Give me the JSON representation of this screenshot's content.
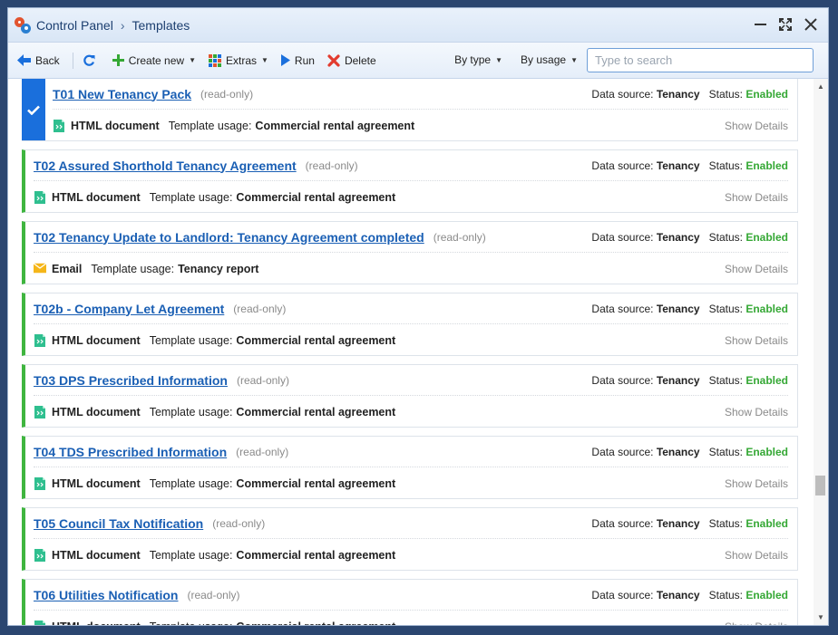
{
  "titlebar": {
    "breadcrumb": [
      "Control Panel",
      "Templates"
    ]
  },
  "toolbar": {
    "back_label": "Back",
    "create_label": "Create new",
    "extras_label": "Extras",
    "run_label": "Run",
    "delete_label": "Delete",
    "filter_type_label": "By type",
    "filter_usage_label": "By usage",
    "search_placeholder": "Type to search"
  },
  "labels": {
    "data_source": "Data source:",
    "status": "Status:",
    "template_usage": "Template usage:",
    "show_details": "Show Details",
    "read_only": "(read-only)"
  },
  "colors": {
    "accent": "#1a6fdc",
    "enabled": "#35a835",
    "card_border": "#3fb53f"
  },
  "templates": [
    {
      "title": "T01 New Tenancy Pack",
      "data_source": "Tenancy",
      "status": "Enabled",
      "doc_type": "HTML document",
      "doc_icon": "html-document-icon",
      "usage": "Commercial rental agreement",
      "selected": true
    },
    {
      "title": "T02 Assured Shorthold Tenancy Agreement",
      "data_source": "Tenancy",
      "status": "Enabled",
      "doc_type": "HTML document",
      "doc_icon": "html-document-icon",
      "usage": "Commercial rental agreement"
    },
    {
      "title": "T02 Tenancy Update to Landlord: Tenancy Agreement completed",
      "data_source": "Tenancy",
      "status": "Enabled",
      "doc_type": "Email",
      "doc_icon": "email-icon",
      "usage": "Tenancy report"
    },
    {
      "title": "T02b - Company Let Agreement",
      "data_source": "Tenancy",
      "status": "Enabled",
      "doc_type": "HTML document",
      "doc_icon": "html-document-icon",
      "usage": "Commercial rental agreement"
    },
    {
      "title": "T03 DPS Prescribed Information",
      "data_source": "Tenancy",
      "status": "Enabled",
      "doc_type": "HTML document",
      "doc_icon": "html-document-icon",
      "usage": "Commercial rental agreement"
    },
    {
      "title": "T04 TDS Prescribed Information",
      "data_source": "Tenancy",
      "status": "Enabled",
      "doc_type": "HTML document",
      "doc_icon": "html-document-icon",
      "usage": "Commercial rental agreement"
    },
    {
      "title": "T05 Council Tax Notification",
      "data_source": "Tenancy",
      "status": "Enabled",
      "doc_type": "HTML document",
      "doc_icon": "html-document-icon",
      "usage": "Commercial rental agreement"
    },
    {
      "title": "T06 Utilities Notification",
      "data_source": "Tenancy",
      "status": "Enabled",
      "doc_type": "HTML document",
      "doc_icon": "html-document-icon",
      "usage": "Commercial rental agreement"
    }
  ]
}
